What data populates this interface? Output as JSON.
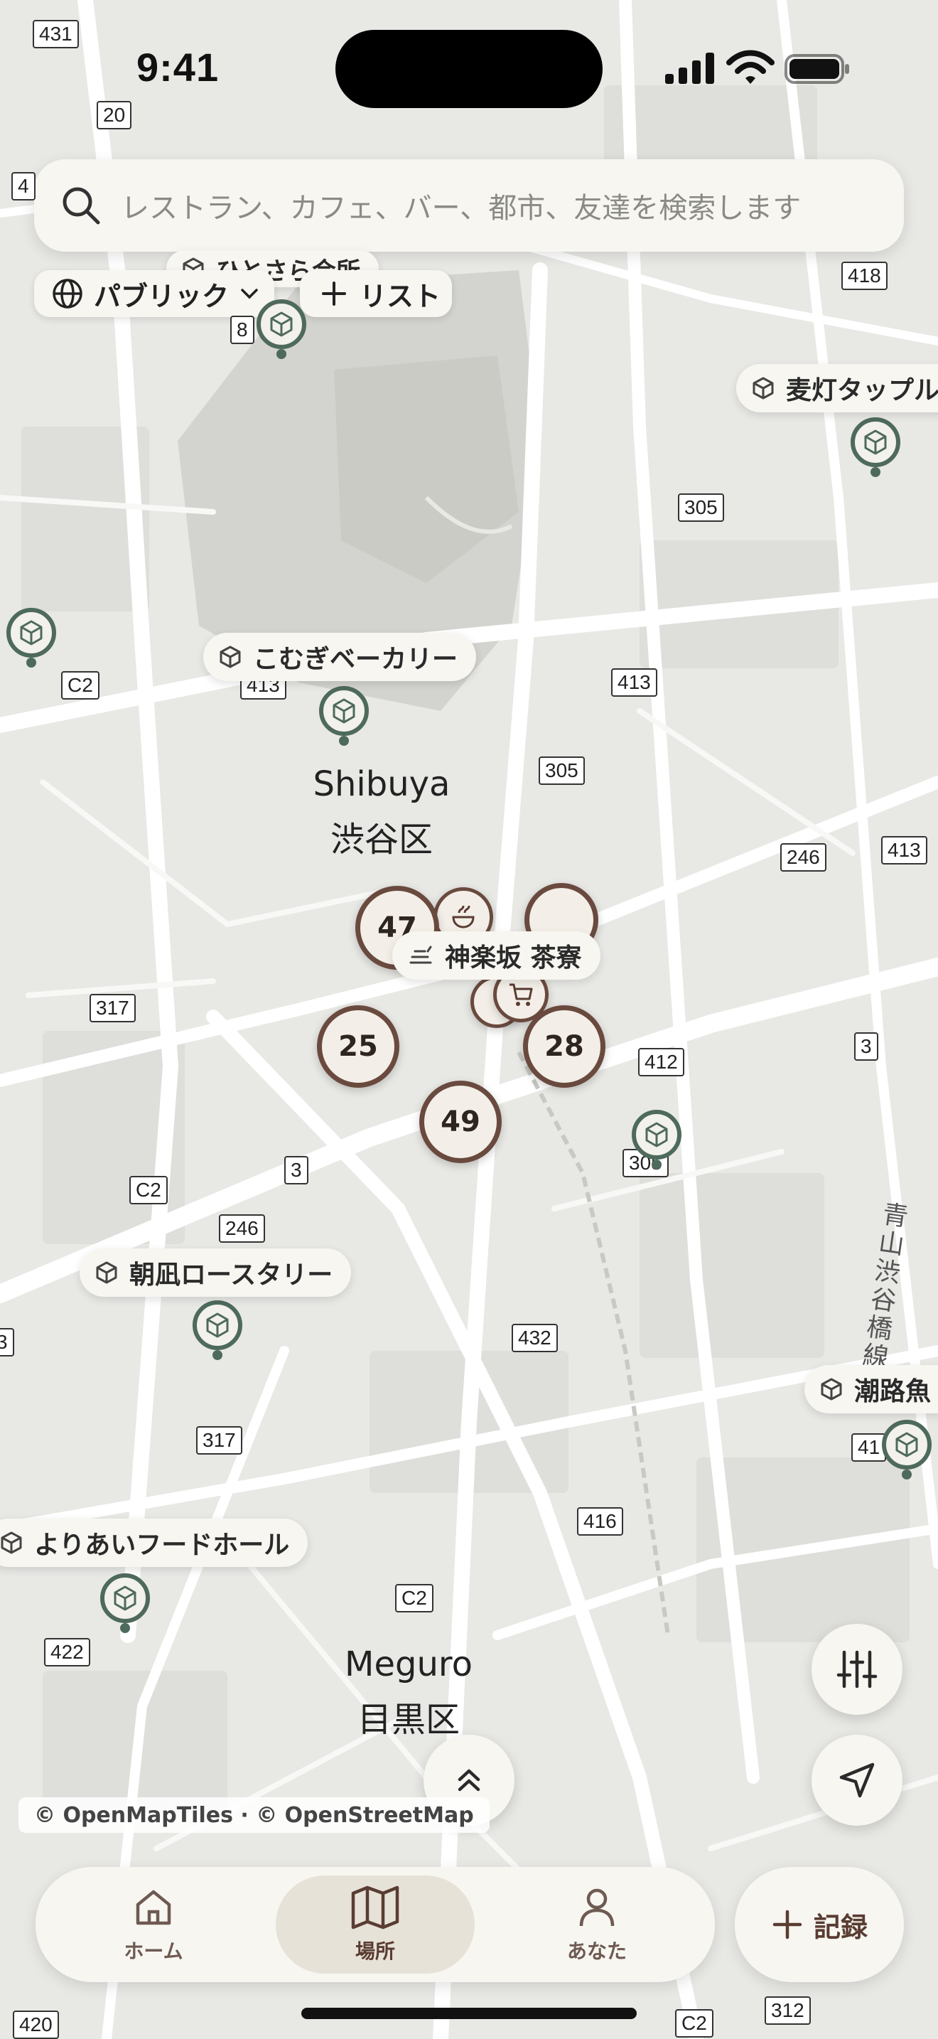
{
  "status_bar": {
    "time": "9:41"
  },
  "search": {
    "placeholder": "レストラン、カフェ、バー、都市、友達を検索します"
  },
  "filters": {
    "visibility_label": "パブリック",
    "add_list_label": "リスト"
  },
  "area_labels": {
    "shibuya_en": "Shibuya",
    "shibuya_ja": "渋谷区",
    "meguro_en": "Meguro",
    "meguro_ja": "目黒区",
    "aoyama_street": "青山渋谷橋線"
  },
  "places": [
    {
      "name": "こむぎベーカリー",
      "icon": "cube-icon"
    },
    {
      "name": "麦灯タップル",
      "icon": "cube-icon"
    },
    {
      "name": "神楽坂 茶寮",
      "icon": "stacked-bowls-icon"
    },
    {
      "name": "朝凪ロースタリー",
      "icon": "cube-icon"
    },
    {
      "name": "潮路魚",
      "icon": "cube-icon"
    },
    {
      "name": "よりあいフードホール",
      "icon": "cube-icon"
    },
    {
      "name": "ひとさら会所",
      "icon": "cube-icon"
    }
  ],
  "clusters": {
    "c47": "47",
    "c25": "25",
    "c28": "28",
    "c49": "49"
  },
  "road_numbers": {
    "r431": "431",
    "r20": "20",
    "r4": "4",
    "r418": "418",
    "r8": "8",
    "r305a": "305",
    "rC2a": "C2",
    "r413a": "413",
    "r413b": "413",
    "r305b": "305",
    "r246a": "246",
    "r413c": "413",
    "r317a": "317",
    "r412": "412",
    "r3a": "3",
    "rC2b": "C2",
    "r3b": "3",
    "r305c": "305",
    "r246b": "246",
    "r3c": "3",
    "r432": "432",
    "r317b": "317",
    "r41": "41",
    "r416": "416",
    "rC2c": "C2",
    "r422": "422",
    "r420": "420",
    "rC2d": "C2",
    "r312": "312"
  },
  "attribution": "© OpenMapTiles · © OpenStreetMap",
  "tabs": [
    {
      "label": "ホーム",
      "icon": "home-icon"
    },
    {
      "label": "場所",
      "icon": "map-icon"
    },
    {
      "label": "あなた",
      "icon": "person-icon"
    }
  ],
  "record_button": {
    "label": "記録",
    "icon": "plus-icon"
  },
  "colors": {
    "pin_green": "#4e6a5c",
    "cluster_brown": "#6a4a3e",
    "surface": "#f7f6f1"
  }
}
